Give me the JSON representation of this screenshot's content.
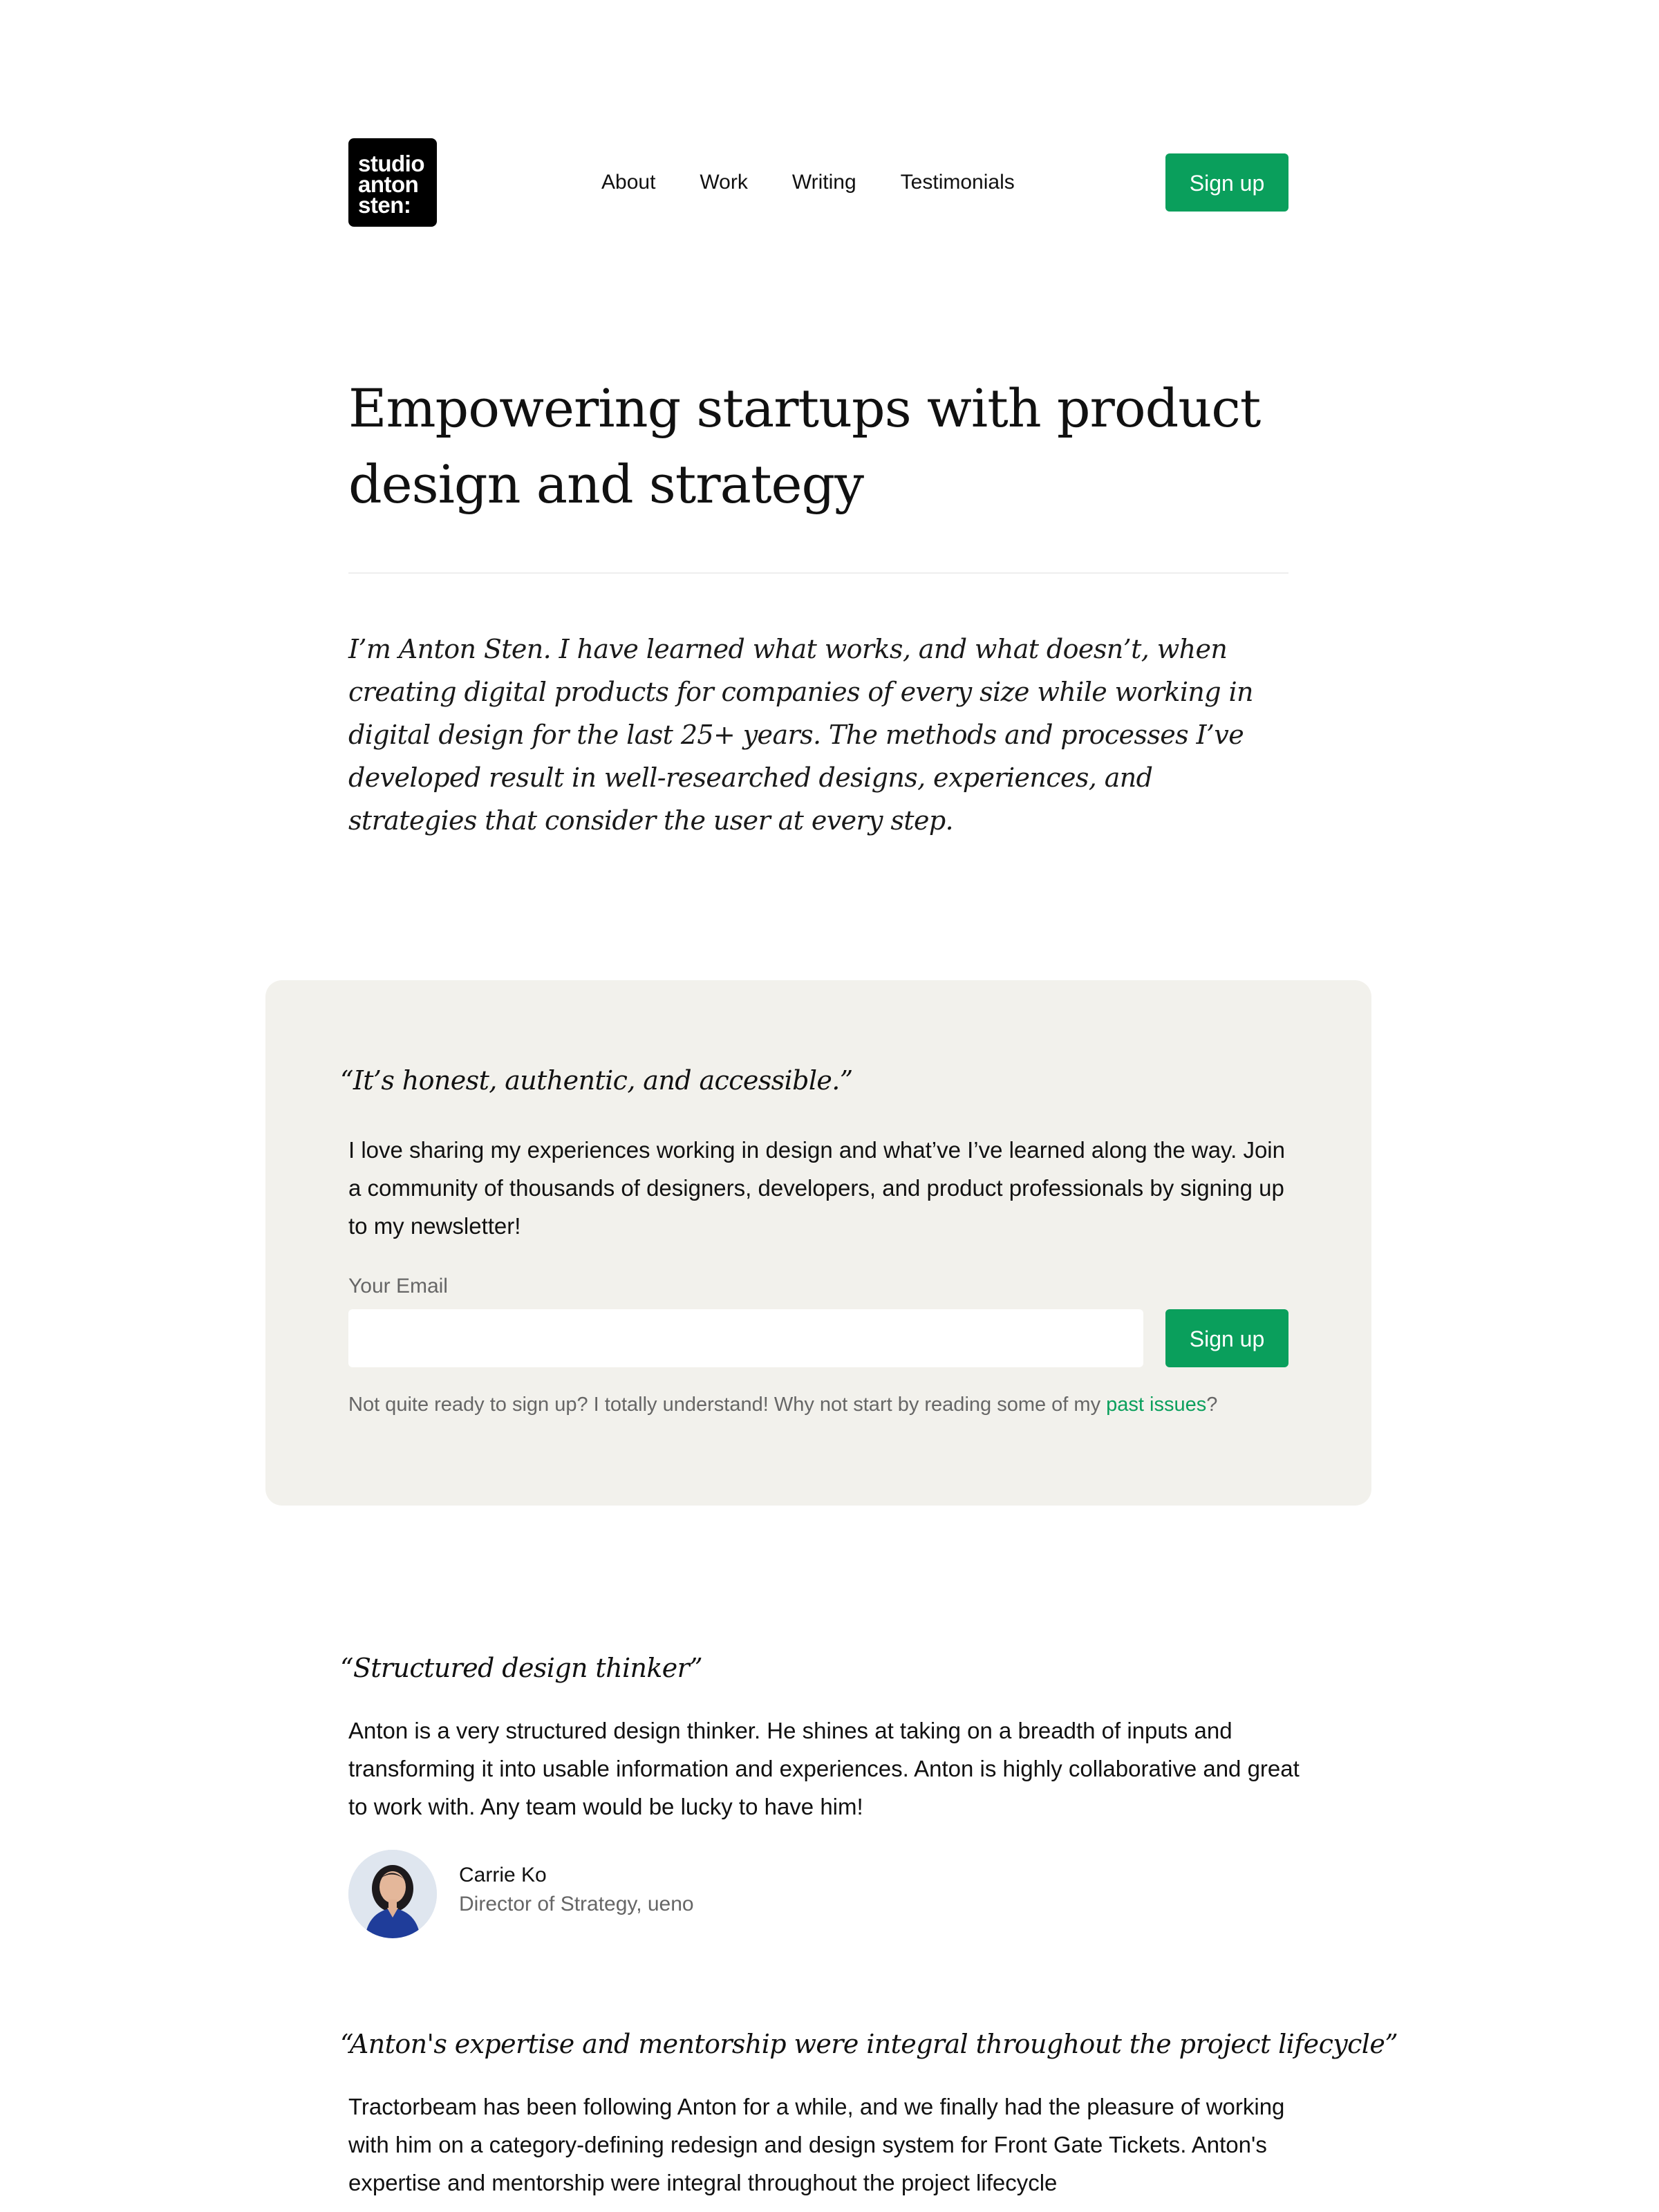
{
  "header": {
    "logo_lines": [
      "studio",
      "anton",
      "sten:"
    ],
    "nav": [
      {
        "label": "About"
      },
      {
        "label": "Work"
      },
      {
        "label": "Writing"
      },
      {
        "label": "Testimonials"
      }
    ],
    "signup_label": "Sign up"
  },
  "hero": {
    "title": "Empowering startups with product design and strategy",
    "intro": "I’m Anton Sten. I have learned what works, and what doesn’t, when creating digital products for companies of every size while working in digital design for the last 25+ years. The methods and processes I’ve developed result in well-researched designs, experiences, and strategies that consider the user at every step."
  },
  "newsletter": {
    "quote": "“It’s honest, authentic, and accessible.”",
    "body": "I love sharing my experiences working in design and what’ve I’ve learned along the way. Join a community of thousands of designers, developers, and product professionals by signing up to my newsletter!",
    "email_label": "Your Email",
    "email_value": "",
    "signup_label": "Sign up",
    "note_prefix": "Not quite ready to sign up? I totally understand! Why not start by reading some of my ",
    "note_link": "past issues",
    "note_suffix": "?"
  },
  "testimonials": [
    {
      "quote": "“Structured design thinker”",
      "body": "Anton is a very structured design thinker. He shines at taking on a breadth of inputs and transforming it into usable information and experiences. Anton is highly collaborative and great to work with. Any team would be lucky to have him!",
      "name": "Carrie Ko",
      "role": "Director of Strategy, ueno"
    },
    {
      "quote": "“Anton's expertise and mentorship were integral throughout the project lifecycle”",
      "body": "Tractorbeam has been following Anton for a while, and we finally had the pleasure of working with him on a category-defining redesign and design system for Front Gate Tickets. Anton's expertise and mentorship were integral throughout the project lifecycle"
    }
  ],
  "colors": {
    "accent": "#0a9f5c",
    "newsletter_bg": "#f2f1ec",
    "text": "#111111",
    "muted": "#666666"
  }
}
